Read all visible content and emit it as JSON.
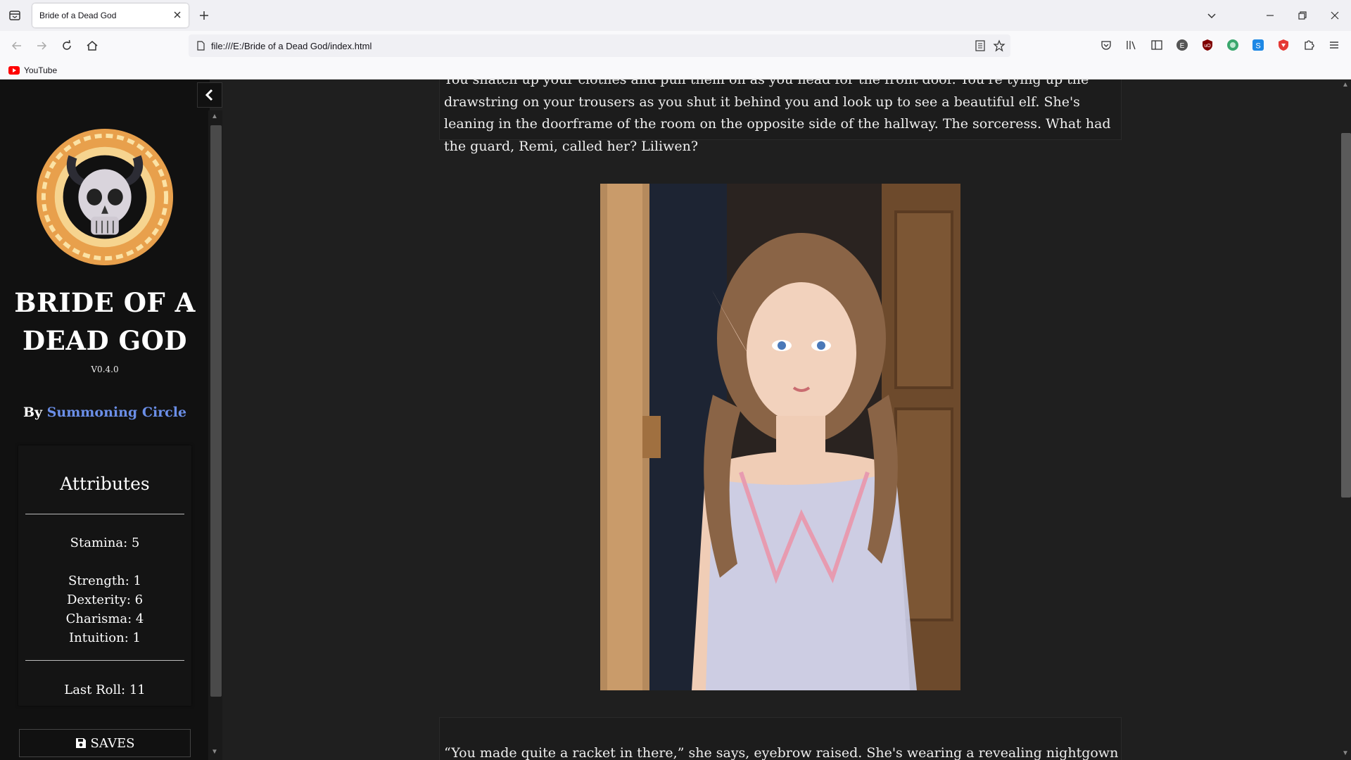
{
  "browser": {
    "tab_title": "Bride of a Dead God",
    "url": "file:///E:/Bride of a Dead God/index.html",
    "bookmark_label": "YouTube"
  },
  "sidebar": {
    "title": "BRIDE OF A DEAD GOD",
    "version": "V0.4.0",
    "by_label": "By",
    "author": "Summoning Circle",
    "attributes": {
      "heading": "Attributes",
      "stamina": "Stamina: 5",
      "strength": "Strength: 1",
      "dexterity": "Dexterity: 6",
      "charisma": "Charisma: 4",
      "intuition": "Intuition: 1",
      "last_roll": "Last Roll: 11"
    },
    "saves_label": "SAVES"
  },
  "passage": {
    "text": "You snatch up your clothes and pull them on as you head for the front door. You're tying up the drawstring on your trousers as you shut it behind you and look up to see a beautiful elf. She's leaning in the doorframe of the room on the opposite side of the hallway. The sorceress. What had the guard, Remi, called her? Liliwen?",
    "next_text": "“You made quite a racket in there,” she says, eyebrow raised. She's wearing a revealing nightgown and"
  },
  "colors": {
    "author_link": "#6b8fe8",
    "sidebar_bg": "#111111",
    "page_bg": "#1f1f1f"
  }
}
